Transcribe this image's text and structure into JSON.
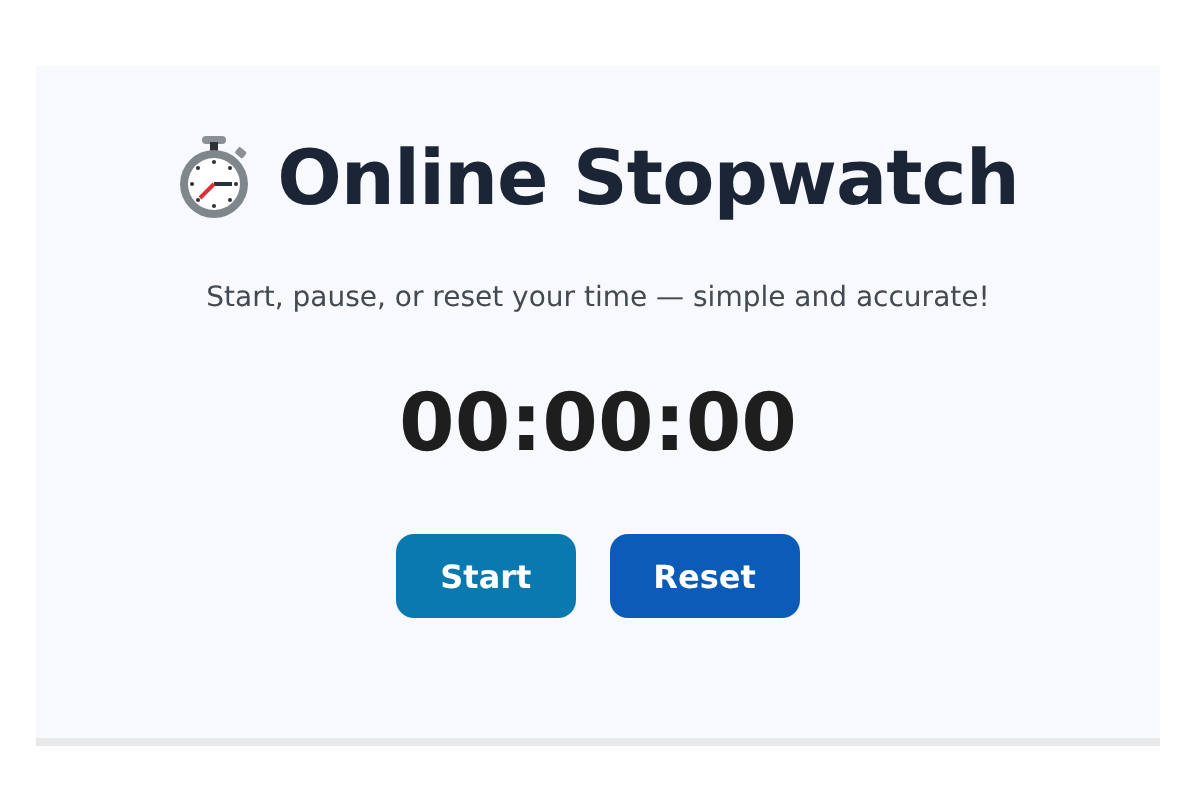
{
  "title": "Online Stopwatch",
  "subtitle": "Start, pause, or reset your time — simple and accurate!",
  "time": "00:00:00",
  "buttons": [
    {
      "label": "Start",
      "kind": "start"
    },
    {
      "label": "Reset",
      "kind": "reset"
    }
  ]
}
